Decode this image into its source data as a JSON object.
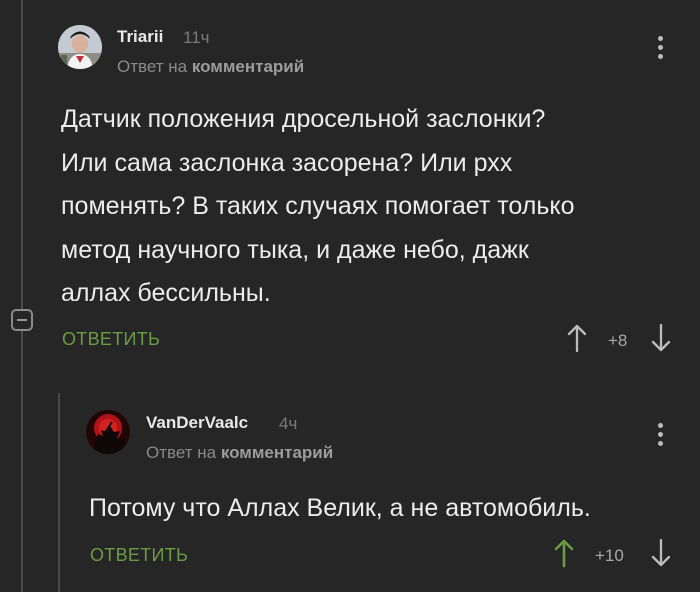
{
  "comments": [
    {
      "username": "Triarii",
      "time": "11ч",
      "reply_prefix": "Ответ на",
      "reply_target": "комментарий",
      "body_lines": [
        "Датчик положения дросельной заслонки?",
        "Или сама заслонка засорена? Или рхх",
        "поменять? В таких случаях помогает только",
        "метод научного тыка, и даже небо, дажк",
        "аллах бессильны."
      ],
      "reply_label": "ОТВЕТИТЬ",
      "score": "+8"
    },
    {
      "username": "VanDerVaalc",
      "time": "4ч",
      "reply_prefix": "Ответ на",
      "reply_target": "комментарий",
      "body_lines": [
        "Потому что Аллах Велик, а не автомобиль."
      ],
      "reply_label": "ОТВЕТИТЬ",
      "score": "+10"
    }
  ],
  "colors": {
    "background": "#262626",
    "accent_green": "#6a9d43",
    "text": "#ececec",
    "muted": "#8a8a8a"
  }
}
